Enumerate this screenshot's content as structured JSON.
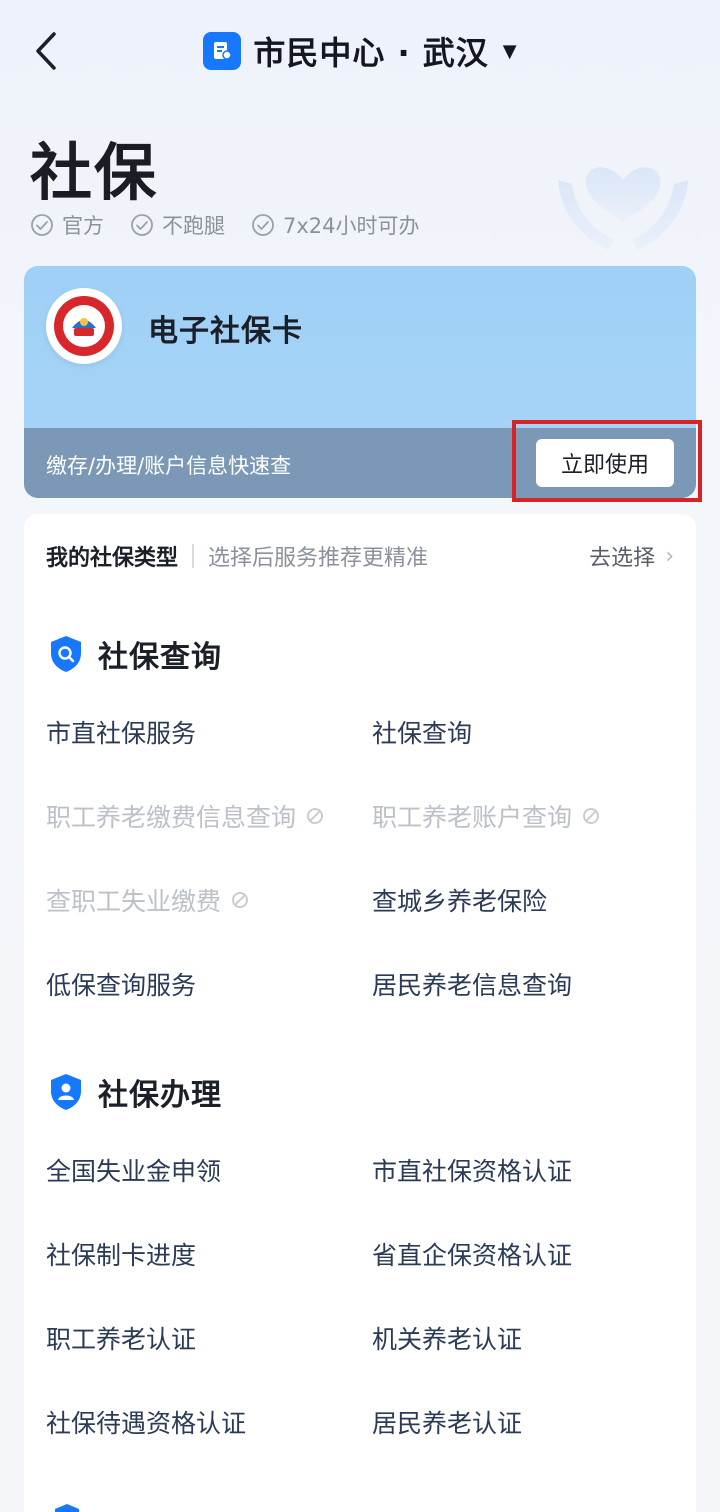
{
  "header": {
    "title": "市民中心 · 武汉",
    "back_icon": "chevron-left-icon",
    "app_icon": "citizen-card-icon",
    "caret_icon": "caret-down-icon"
  },
  "hero": {
    "title": "社保",
    "badges": [
      "官方",
      "不跑腿",
      "7x24小时可办"
    ]
  },
  "card": {
    "title": "电子社保卡",
    "desc": "缴存/办理/账户信息快速查",
    "button": "立即使用",
    "colors": {
      "card_bg": "#a5d3f7",
      "card_bottom": "#7b99b6",
      "highlight": "#d62424"
    }
  },
  "type_row": {
    "label": "我的社保类型",
    "hint": "选择后服务推荐更精准",
    "action": "去选择"
  },
  "sections": [
    {
      "title": "社保查询",
      "icon": "search-shield-icon",
      "items": [
        {
          "label": "市直社保服务",
          "disabled": false
        },
        {
          "label": "社保查询",
          "disabled": false
        },
        {
          "label": "职工养老缴费信息查询",
          "disabled": true
        },
        {
          "label": "职工养老账户查询",
          "disabled": true
        },
        {
          "label": "查职工失业缴费",
          "disabled": true
        },
        {
          "label": "查城乡养老保险",
          "disabled": false
        },
        {
          "label": "低保查询服务",
          "disabled": false
        },
        {
          "label": "居民养老信息查询",
          "disabled": false
        }
      ]
    },
    {
      "title": "社保办理",
      "icon": "user-shield-icon",
      "items": [
        {
          "label": "全国失业金申领",
          "disabled": false
        },
        {
          "label": "市直社保资格认证",
          "disabled": false
        },
        {
          "label": "社保制卡进度",
          "disabled": false
        },
        {
          "label": "省直企保资格认证",
          "disabled": false
        },
        {
          "label": "职工养老认证",
          "disabled": false
        },
        {
          "label": "机关养老认证",
          "disabled": false
        },
        {
          "label": "社保待遇资格认证",
          "disabled": false
        },
        {
          "label": "居民养老认证",
          "disabled": false
        }
      ]
    }
  ]
}
